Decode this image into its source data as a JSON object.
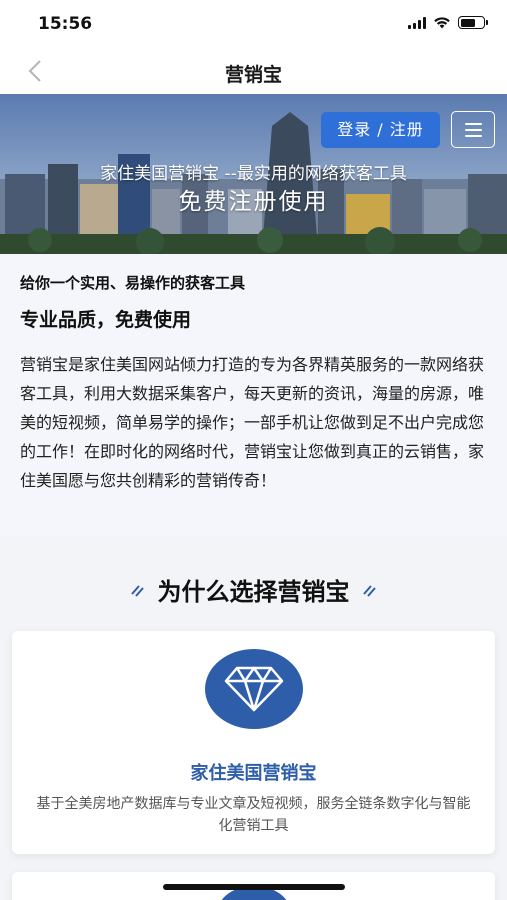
{
  "status_bar": {
    "time": "15:56",
    "signal_icon": "signal-icon",
    "wifi_icon": "wifi-icon",
    "battery_icon": "battery-icon"
  },
  "nav": {
    "title": "营销宝",
    "back_icon": "chevron-left-icon"
  },
  "banner": {
    "login_label": "登录 / 注册",
    "menu_icon": "hamburger-menu-icon",
    "tagline": "家住美国营销宝 --最实用的网络获客工具",
    "cta": "免费注册使用"
  },
  "intro": {
    "subtitle": "给你一个实用、易操作的获客工具",
    "title": "专业品质，免费使用",
    "body": "营销宝是家住美国网站倾力打造的专为各界精英服务的一款网络获客工具，利用大数据采集客户，每天更新的资讯，海量的房源，唯美的短视频，简单易学的操作；一部手机让您做到足不出户完成您的工作！在即时化的网络时代，营销宝让您做到真正的云销售，家住美国愿与您共创精彩的营销传奇！"
  },
  "why": {
    "title": "为什么选择营销宝"
  },
  "feature_card": {
    "icon": "diamond-icon",
    "title": "家住美国营销宝",
    "description": "基于全美房地产数据库与专业文章及短视频，服务全链条数字化与智能化营销工具"
  },
  "colors": {
    "accent_blue": "#2e5eaa",
    "button_blue": "#2f6fd8"
  }
}
